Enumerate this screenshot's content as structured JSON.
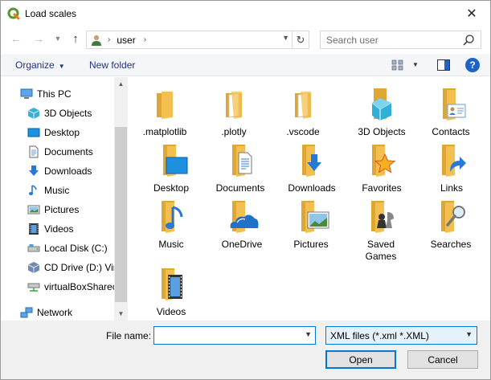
{
  "window": {
    "title": "Load scales",
    "close_glyph": "✕"
  },
  "nav": {
    "back_glyph": "←",
    "forward_glyph": "→",
    "recent_glyph": "⌄",
    "up_glyph": "↑",
    "address_segment": "user",
    "refresh_glyph": "↻",
    "search_placeholder": "Search user"
  },
  "command_bar": {
    "organize_label": "Organize",
    "new_folder_label": "New folder",
    "help_label": "?"
  },
  "sidebar": {
    "items": [
      {
        "label": "This PC",
        "icon": "pc-icon"
      },
      {
        "label": "3D Objects",
        "icon": "3d-objects-icon"
      },
      {
        "label": "Desktop",
        "icon": "desktop-icon"
      },
      {
        "label": "Documents",
        "icon": "documents-icon"
      },
      {
        "label": "Downloads",
        "icon": "downloads-icon"
      },
      {
        "label": "Music",
        "icon": "music-icon"
      },
      {
        "label": "Pictures",
        "icon": "pictures-icon"
      },
      {
        "label": "Videos",
        "icon": "videos-icon"
      },
      {
        "label": "Local Disk (C:)",
        "icon": "local-disk-icon"
      },
      {
        "label": "CD Drive (D:) Vir",
        "icon": "cd-drive-icon"
      },
      {
        "label": "virtualBoxSharec",
        "icon": "network-drive-icon"
      },
      {
        "label": "Network",
        "icon": "network-icon"
      }
    ]
  },
  "files": [
    {
      "name": ".matplotlib",
      "icon": "folder-icon"
    },
    {
      "name": ".plotly",
      "icon": "folder-pages-icon"
    },
    {
      "name": ".vscode",
      "icon": "folder-pages-icon"
    },
    {
      "name": "3D Objects",
      "icon": "3d-objects-folder-icon"
    },
    {
      "name": "Contacts",
      "icon": "contacts-folder-icon"
    },
    {
      "name": "Desktop",
      "icon": "desktop-folder-icon"
    },
    {
      "name": "Documents",
      "icon": "documents-folder-icon"
    },
    {
      "name": "Downloads",
      "icon": "downloads-folder-icon"
    },
    {
      "name": "Favorites",
      "icon": "favorites-folder-icon"
    },
    {
      "name": "Links",
      "icon": "links-folder-icon"
    },
    {
      "name": "Music",
      "icon": "music-folder-icon"
    },
    {
      "name": "OneDrive",
      "icon": "onedrive-folder-icon"
    },
    {
      "name": "Pictures",
      "icon": "pictures-folder-icon"
    },
    {
      "name": "Saved\nGames",
      "icon": "saved-games-folder-icon"
    },
    {
      "name": "Searches",
      "icon": "searches-folder-icon"
    },
    {
      "name": "Videos",
      "icon": "videos-folder-icon"
    }
  ],
  "bottom": {
    "file_name_label": "File name:",
    "file_name_value": "",
    "filter_value": "XML files (*.xml *.XML)",
    "open_label": "Open",
    "cancel_label": "Cancel"
  },
  "colors": {
    "folder": "#f3c04f",
    "folder_dark": "#dea735",
    "accent": "#0078d7",
    "link_blue": "#1e3287"
  }
}
